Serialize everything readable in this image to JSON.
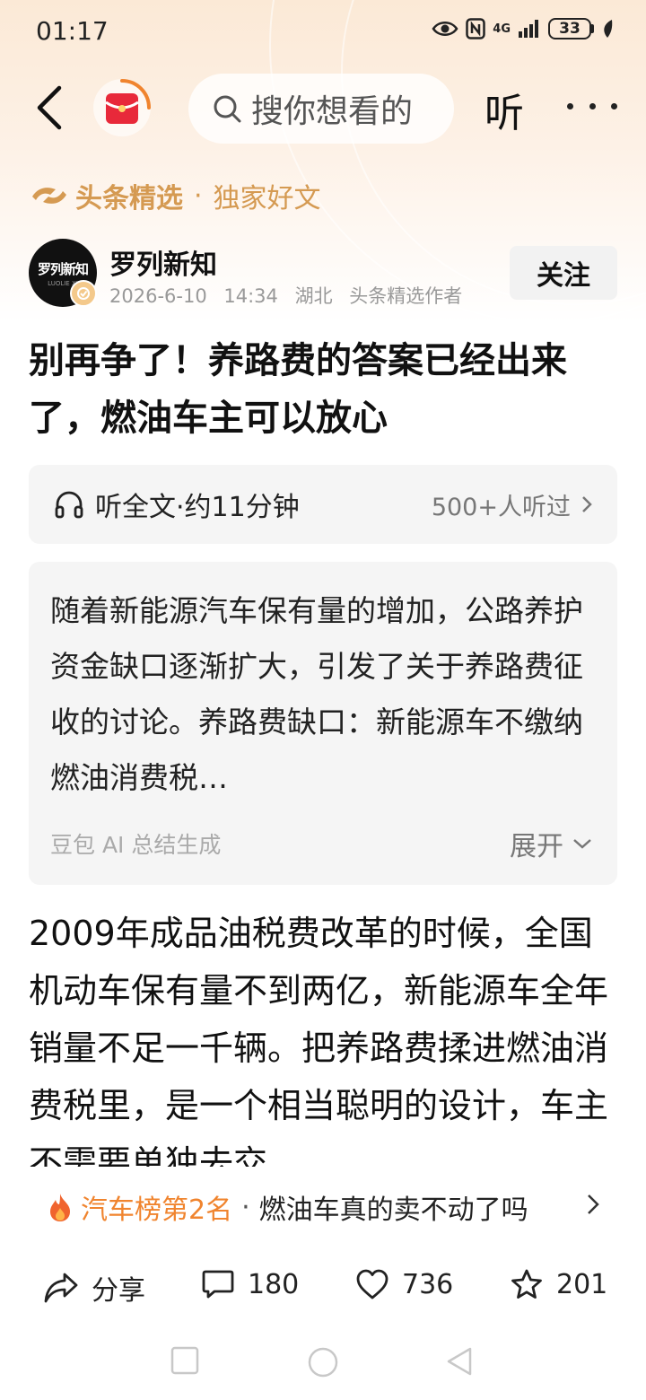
{
  "status_bar": {
    "time": "01:17",
    "network": "4G",
    "battery": "33"
  },
  "nav": {
    "search_placeholder": "搜你想看的",
    "listen_label": "听"
  },
  "channel": {
    "brand": "头条精选",
    "separator": "·",
    "subtitle": "独家好文"
  },
  "author": {
    "name": "罗列新知",
    "avatar_text": "罗列新知",
    "avatar_subtext": "LUOLIE XI",
    "date": "2026-6-10",
    "time": "14:34",
    "location": "湖北",
    "role": "头条精选作者",
    "follow_label": "关注"
  },
  "article": {
    "title": "别再争了！养路费的答案已经出来了，燃油车主可以放心",
    "listen": {
      "label": "听全文·约11分钟",
      "count": "500+人听过"
    },
    "summary": {
      "text": "随着新能源汽车保有量的增加，公路养护资金缺口逐渐扩大，引发了关于养路费征收的讨论。养路费缺口：新能源车不缴纳燃油消费税…",
      "source": "豆包 AI 总结生成",
      "expand_label": "展开"
    },
    "body": "2009年成品油税费改革的时候，全国机动车保有量不到两亿，新能源车全年销量不足一千辆。把养路费揉进燃油消费税里，是一个相当聪明的设计，车主不需要单独去交"
  },
  "ranking": {
    "title": "汽车榜第2名",
    "separator": "·",
    "topic": "燃油车真的卖不动了吗"
  },
  "actions": {
    "share_label": "分享",
    "comments": "180",
    "likes": "736",
    "favorites": "201"
  },
  "colors": {
    "accent_orange": "#f0842e",
    "brand_gold": "#d59a52",
    "logo_red": "#e8293a"
  }
}
